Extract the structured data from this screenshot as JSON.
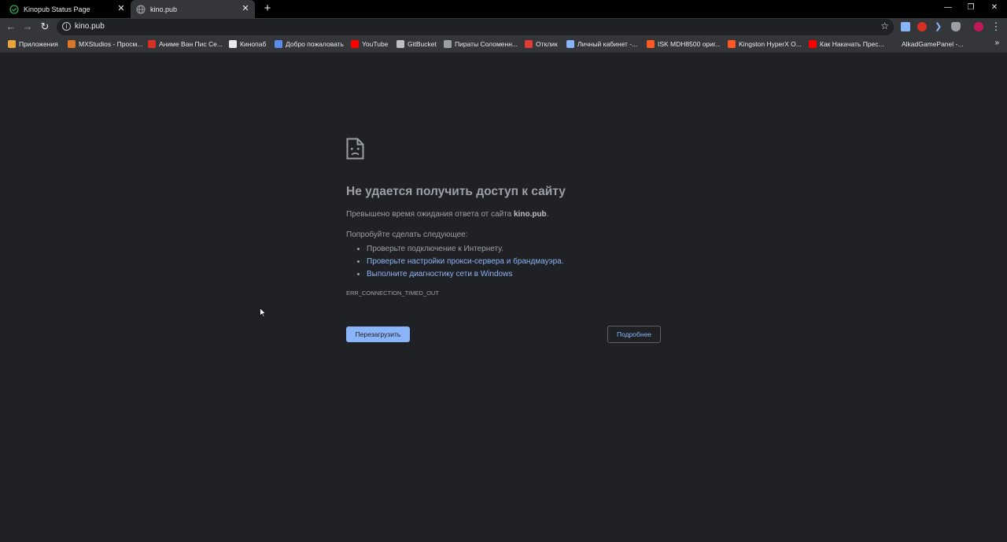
{
  "tabs": [
    {
      "title": "Kinopub Status Page",
      "active": false
    },
    {
      "title": "kino.pub",
      "active": true
    }
  ],
  "toolbar": {
    "url": "kino.pub"
  },
  "bookmarks": {
    "items": [
      {
        "label": "Приложения",
        "icon_color": "#e8a33a"
      },
      {
        "label": "MXStudios - Просм...",
        "icon_color": "#d9782d"
      },
      {
        "label": "Аниме Ван Пис Се...",
        "icon_color": "#d93025"
      },
      {
        "label": "Кинопаб",
        "icon_color": "#e8eaed"
      },
      {
        "label": "Добро пожаловать",
        "icon_color": "#5b8def"
      },
      {
        "label": "YouTube",
        "icon_color": "#ff0000"
      },
      {
        "label": "GitBucket",
        "icon_color": "#bdc1c6"
      },
      {
        "label": "Пираты Соломенн...",
        "icon_color": "#9aa0a6"
      },
      {
        "label": "Отклик",
        "icon_color": "#e53935"
      },
      {
        "label": "Личный кабинет -...",
        "icon_color": "#8ab4f8"
      },
      {
        "label": "ISK MDH8500 ориг...",
        "icon_color": "#ff5722"
      },
      {
        "label": "Kingston HyperX O...",
        "icon_color": "#ff5722"
      },
      {
        "label": "Как Накачать Прес...",
        "icon_color": "#ff0000"
      },
      {
        "label": "AlkadGamePanel -...",
        "icon_color": ""
      }
    ]
  },
  "error": {
    "title": "Не удается получить доступ к сайту",
    "desc_prefix": "Превышено время ожидания ответа от сайта ",
    "desc_host": "kino.pub",
    "desc_suffix": ".",
    "try_label": "Попробуйте сделать следующее:",
    "suggestions": [
      "Проверьте подключение к Интернету.",
      "Проверьте настройки прокси-сервера и брандмауэра.",
      "Выполните диагностику сети в Windows"
    ],
    "code": "ERR_CONNECTION_TIMED_OUT",
    "reload_label": "Перезагрузить",
    "details_label": "Подробнее"
  },
  "colors": {
    "background": "#202124",
    "accent": "#8ab4f8",
    "text": "#9aa0a6"
  },
  "icons": {
    "tab1_favicon": "check-circle-icon",
    "tab2_favicon": "globe-icon",
    "error_illustration": "sad-page-icon"
  }
}
